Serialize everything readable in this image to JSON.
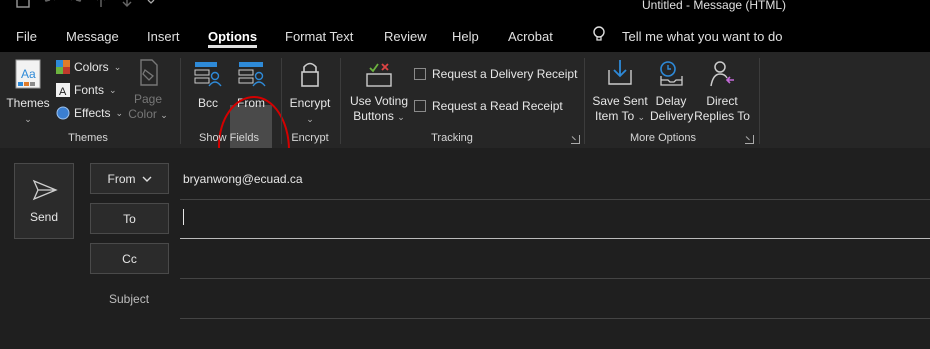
{
  "titlebar": {
    "title": "Untitled  -  Message (HTML)",
    "qat_icons": [
      "save-icon",
      "undo-icon",
      "redo-icon",
      "up-arrow-icon",
      "down-arrow-icon",
      "customize-qat-icon"
    ]
  },
  "menu": {
    "tabs": [
      {
        "label": "File"
      },
      {
        "label": "Message"
      },
      {
        "label": "Insert"
      },
      {
        "label": "Options"
      },
      {
        "label": "Format Text"
      },
      {
        "label": "Review"
      },
      {
        "label": "Help"
      },
      {
        "label": "Acrobat"
      }
    ],
    "active_tab": "Options",
    "tell_me": "Tell me what you want to do"
  },
  "ribbon": {
    "themes": {
      "label": "Themes",
      "themes_button": "Themes",
      "colors": "Colors",
      "fonts": "Fonts",
      "effects": "Effects",
      "page_color_line1": "Page",
      "page_color_line2": "Color"
    },
    "show_fields": {
      "label": "Show Fields",
      "bcc": "Bcc",
      "from": "From"
    },
    "encrypt": {
      "label": "Encrypt",
      "button": "Encrypt"
    },
    "tracking": {
      "label": "Tracking",
      "voting_line1": "Use Voting",
      "voting_line2": "Buttons",
      "delivery_receipt": "Request a Delivery Receipt",
      "read_receipt": "Request a Read Receipt"
    },
    "more_options": {
      "label": "More Options",
      "save_sent_line1": "Save Sent",
      "save_sent_line2": "Item To",
      "delay_line1": "Delay",
      "delay_line2": "Delivery",
      "direct_line1": "Direct",
      "direct_line2": "Replies To"
    }
  },
  "compose": {
    "send": "Send",
    "from_button": "From",
    "from_address": "bryanwong@ecuad.ca",
    "to_button": "To",
    "cc_button": "Cc",
    "subject_label": "Subject"
  },
  "colors": {
    "annotation_circle": "#d40000",
    "background": "#1f1f1f",
    "ribbon": "#262626",
    "accent_blue": "#2e8ad8"
  }
}
